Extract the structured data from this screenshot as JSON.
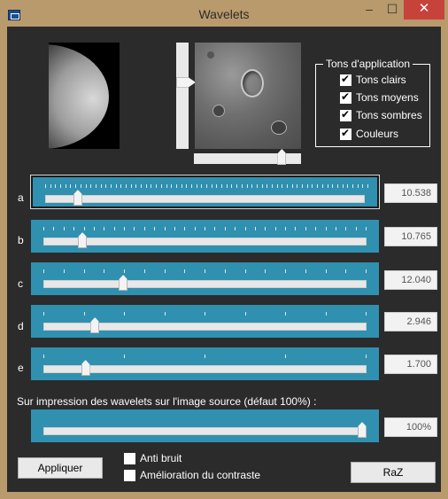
{
  "window": {
    "title": "Wavelets",
    "minimize_label": "–",
    "maximize_label": "☐",
    "close_label": "✕"
  },
  "tones_group": {
    "title": "Tons d'application",
    "options": [
      {
        "label": "Tons clairs",
        "checked": true
      },
      {
        "label": "Tons moyens",
        "checked": true
      },
      {
        "label": "Tons sombres",
        "checked": true
      },
      {
        "label": "Couleurs",
        "checked": true
      }
    ]
  },
  "preview": {
    "vertical_slider_fraction": 0.36,
    "horizontal_slider_fraction": 0.85
  },
  "sliders": [
    {
      "letter": "a",
      "value": "10.538",
      "position": 0.09,
      "tick_count": 65,
      "selected": true
    },
    {
      "letter": "b",
      "value": "10.765",
      "position": 0.11,
      "tick_count": 33,
      "selected": false
    },
    {
      "letter": "c",
      "value": "12.040",
      "position": 0.24,
      "tick_count": 17,
      "selected": false
    },
    {
      "letter": "d",
      "value": "2.946",
      "position": 0.15,
      "tick_count": 9,
      "selected": false
    },
    {
      "letter": "e",
      "value": "1.700",
      "position": 0.12,
      "tick_count": 5,
      "selected": false
    }
  ],
  "overprint": {
    "label": "Sur impression des wavelets sur l'image source (défaut 100%) :",
    "value": "100%",
    "position": 1.0
  },
  "footer": {
    "apply_label": "Appliquer",
    "anti_noise_label": "Anti bruit",
    "anti_noise_checked": false,
    "contrast_label": "Amélioration du contraste",
    "contrast_checked": false,
    "reset_label": "RaZ"
  }
}
